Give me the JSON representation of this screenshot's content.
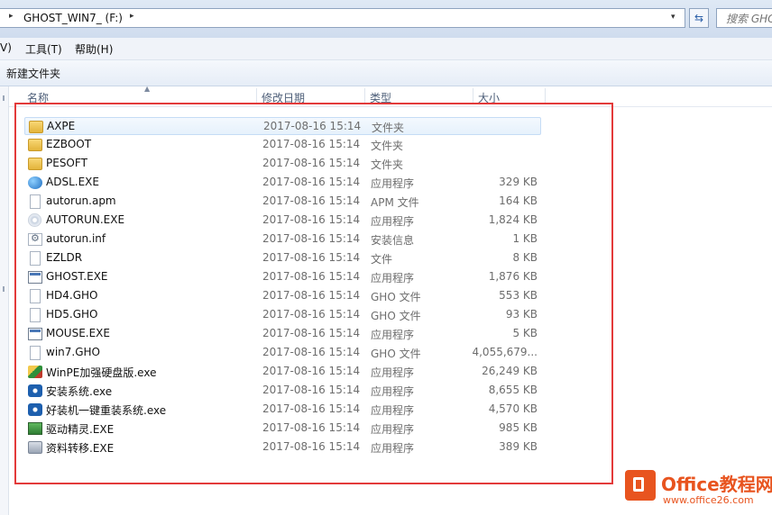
{
  "address": {
    "path_arrow": "▸",
    "path": "GHOST_WIN7_ (F:)",
    "path_arrow_after": "▸",
    "dropdown": "▾",
    "refresh_icon": "refresh-icon",
    "search_placeholder": "搜索 GHO"
  },
  "menu": [
    {
      "label": "V)"
    },
    {
      "label": "工具(T)"
    },
    {
      "label": "帮助(H)"
    }
  ],
  "command_bar": {
    "new_folder": "新建文件夹"
  },
  "columns": {
    "name": "名称",
    "date": "修改日期",
    "type": "类型",
    "size": "大小"
  },
  "files": [
    {
      "name": "AXPE",
      "date": "2017-08-16 15:14",
      "type": "文件夹",
      "size": "",
      "icon": "folder-icon"
    },
    {
      "name": "EZBOOT",
      "date": "2017-08-16 15:14",
      "type": "文件夹",
      "size": "",
      "icon": "folder-icon"
    },
    {
      "name": "PESOFT",
      "date": "2017-08-16 15:14",
      "type": "文件夹",
      "size": "",
      "icon": "folder-icon"
    },
    {
      "name": "ADSL.EXE",
      "date": "2017-08-16 15:14",
      "type": "应用程序",
      "size": "329 KB",
      "icon": "network-globe-icon"
    },
    {
      "name": "autorun.apm",
      "date": "2017-08-16 15:14",
      "type": "APM 文件",
      "size": "164 KB",
      "icon": "document-icon"
    },
    {
      "name": "AUTORUN.EXE",
      "date": "2017-08-16 15:14",
      "type": "应用程序",
      "size": "1,824 KB",
      "icon": "cd-icon"
    },
    {
      "name": "autorun.inf",
      "date": "2017-08-16 15:14",
      "type": "安装信息",
      "size": "1 KB",
      "icon": "settings-file-icon"
    },
    {
      "name": "EZLDR",
      "date": "2017-08-16 15:14",
      "type": "文件",
      "size": "8 KB",
      "icon": "document-icon"
    },
    {
      "name": "GHOST.EXE",
      "date": "2017-08-16 15:14",
      "type": "应用程序",
      "size": "1,876 KB",
      "icon": "application-icon"
    },
    {
      "name": "HD4.GHO",
      "date": "2017-08-16 15:14",
      "type": "GHO 文件",
      "size": "553 KB",
      "icon": "document-icon"
    },
    {
      "name": "HD5.GHO",
      "date": "2017-08-16 15:14",
      "type": "GHO 文件",
      "size": "93 KB",
      "icon": "document-icon"
    },
    {
      "name": "MOUSE.EXE",
      "date": "2017-08-16 15:14",
      "type": "应用程序",
      "size": "5 KB",
      "icon": "application-icon"
    },
    {
      "name": "win7.GHO",
      "date": "2017-08-16 15:14",
      "type": "GHO 文件",
      "size": "4,055,679...",
      "icon": "document-icon"
    },
    {
      "name": "WinPE加强硬盘版.exe",
      "date": "2017-08-16 15:14",
      "type": "应用程序",
      "size": "26,249 KB",
      "icon": "winpe-icon"
    },
    {
      "name": "安装系统.exe",
      "date": "2017-08-16 15:14",
      "type": "应用程序",
      "size": "8,655 KB",
      "icon": "installer-icon"
    },
    {
      "name": "好装机一键重装系统.exe",
      "date": "2017-08-16 15:14",
      "type": "应用程序",
      "size": "4,570 KB",
      "icon": "installer-icon"
    },
    {
      "name": "驱动精灵.EXE",
      "date": "2017-08-16 15:14",
      "type": "应用程序",
      "size": "985 KB",
      "icon": "driver-icon"
    },
    {
      "name": "资料转移.EXE",
      "date": "2017-08-16 15:14",
      "type": "应用程序",
      "size": "389 KB",
      "icon": "user-transfer-icon"
    }
  ],
  "selected_index": 0,
  "watermark": {
    "title": "Office教程网",
    "url": "www.office26.com"
  },
  "colors": {
    "annotation_border": "#e33a3a",
    "watermark": "#e8541f",
    "selection_bg": "#e6f1fc"
  }
}
